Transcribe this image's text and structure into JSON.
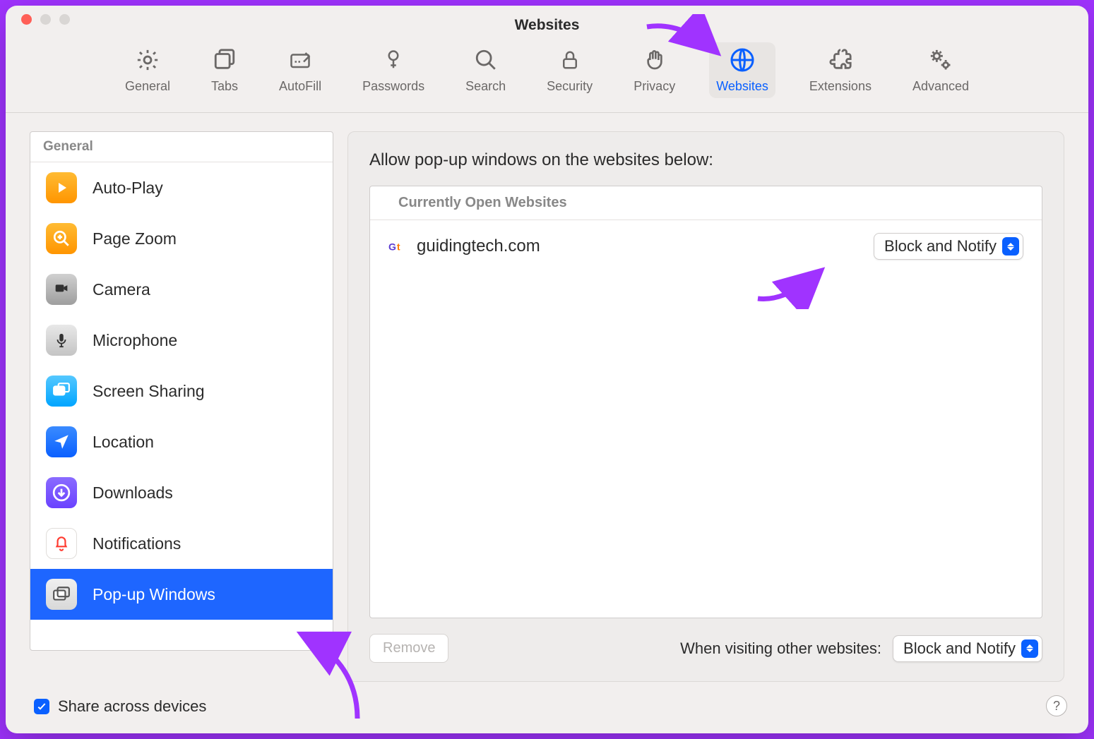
{
  "window": {
    "title": "Websites"
  },
  "toolbar": {
    "items": [
      {
        "label": "General"
      },
      {
        "label": "Tabs"
      },
      {
        "label": "AutoFill"
      },
      {
        "label": "Passwords"
      },
      {
        "label": "Search"
      },
      {
        "label": "Security"
      },
      {
        "label": "Privacy"
      },
      {
        "label": "Websites"
      },
      {
        "label": "Extensions"
      },
      {
        "label": "Advanced"
      }
    ],
    "active_index": 7
  },
  "sidebar": {
    "header": "General",
    "items": [
      {
        "label": "Auto-Play"
      },
      {
        "label": "Page Zoom"
      },
      {
        "label": "Camera"
      },
      {
        "label": "Microphone"
      },
      {
        "label": "Screen Sharing"
      },
      {
        "label": "Location"
      },
      {
        "label": "Downloads"
      },
      {
        "label": "Notifications"
      },
      {
        "label": "Pop-up Windows"
      }
    ],
    "selected_index": 8
  },
  "panel": {
    "heading": "Allow pop-up windows on the websites below:",
    "list_header": "Currently Open Websites",
    "rows": [
      {
        "site": "guidingtech.com",
        "setting": "Block and Notify"
      }
    ],
    "remove_label": "Remove",
    "other_label": "When visiting other websites:",
    "other_setting": "Block and Notify"
  },
  "share": {
    "label": "Share across devices",
    "checked": true
  },
  "help": {
    "label": "?"
  }
}
